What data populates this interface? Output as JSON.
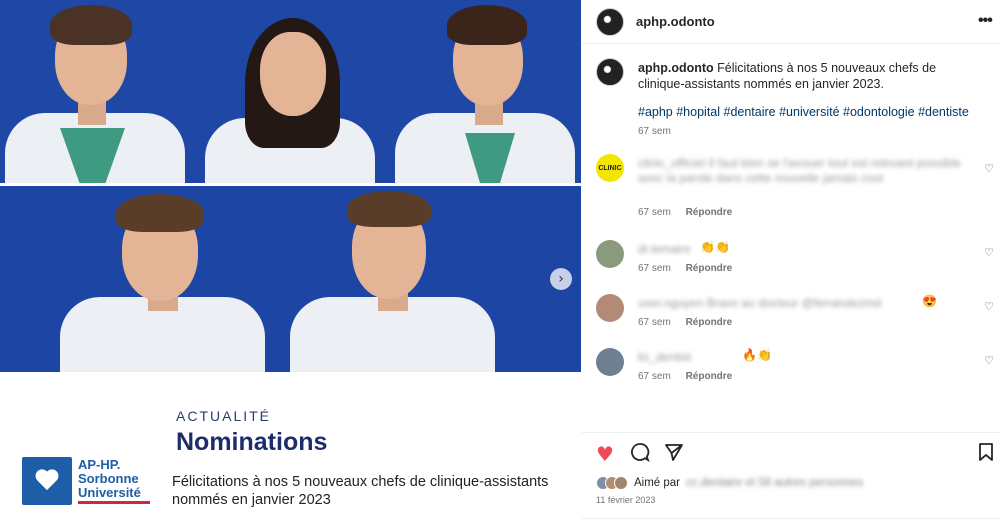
{
  "header": {
    "username": "aphp.odonto",
    "more_icon": "more-options-icon"
  },
  "post": {
    "username": "aphp.odonto",
    "text": "Félicitations à nos 5 nouveaux chefs de clinique-assistants nommés en janvier 2023.",
    "hashtags": "#aphp #hopital #dentaire #université #odontologie #dentiste",
    "time": "67 sem"
  },
  "media": {
    "category": "ACTUALITÉ",
    "title": "Nominations",
    "caption": "Félicitations à nos 5 nouveaux chefs de clinique-assistants nommés en janvier 2023",
    "logo_line1": "AP-HP.",
    "logo_line2": "Sorbonne",
    "logo_line3": "Université",
    "next_icon": "chevron-right-icon"
  },
  "comments": [
    {
      "avatar_label": "CLINIC",
      "blurred": "clinic_officiel Il faut bien se l'avouer tout est relevant possible avec la parole dans cette nouvelle jamais cool",
      "emoji": "",
      "time": "67 sem",
      "reply": "Répondre"
    },
    {
      "avatar_label": "",
      "blurred": "dr.lemaire",
      "emoji": "👏👏",
      "time": "67 sem",
      "reply": "Répondre"
    },
    {
      "avatar_label": "",
      "blurred": "user.nguyen Bravo au docteur @ferrandezmd",
      "emoji": "😍",
      "time": "67 sem",
      "reply": "Répondre"
    },
    {
      "avatar_label": "",
      "blurred": "liz_dentist",
      "emoji": "🔥👏",
      "time": "67 sem",
      "reply": "Répondre"
    }
  ],
  "actions": {
    "like": "heart-filled-icon",
    "comment": "comment-icon",
    "share": "share-icon",
    "save": "bookmark-icon"
  },
  "likes": {
    "prefix": "Aimé par",
    "blurred": "cc.dentaire et 58 autres personnes"
  },
  "date": "11 février 2023",
  "colors": {
    "accent_blue": "#1f47a6",
    "like_red": "#ed4956",
    "hashtag": "#00376b"
  }
}
